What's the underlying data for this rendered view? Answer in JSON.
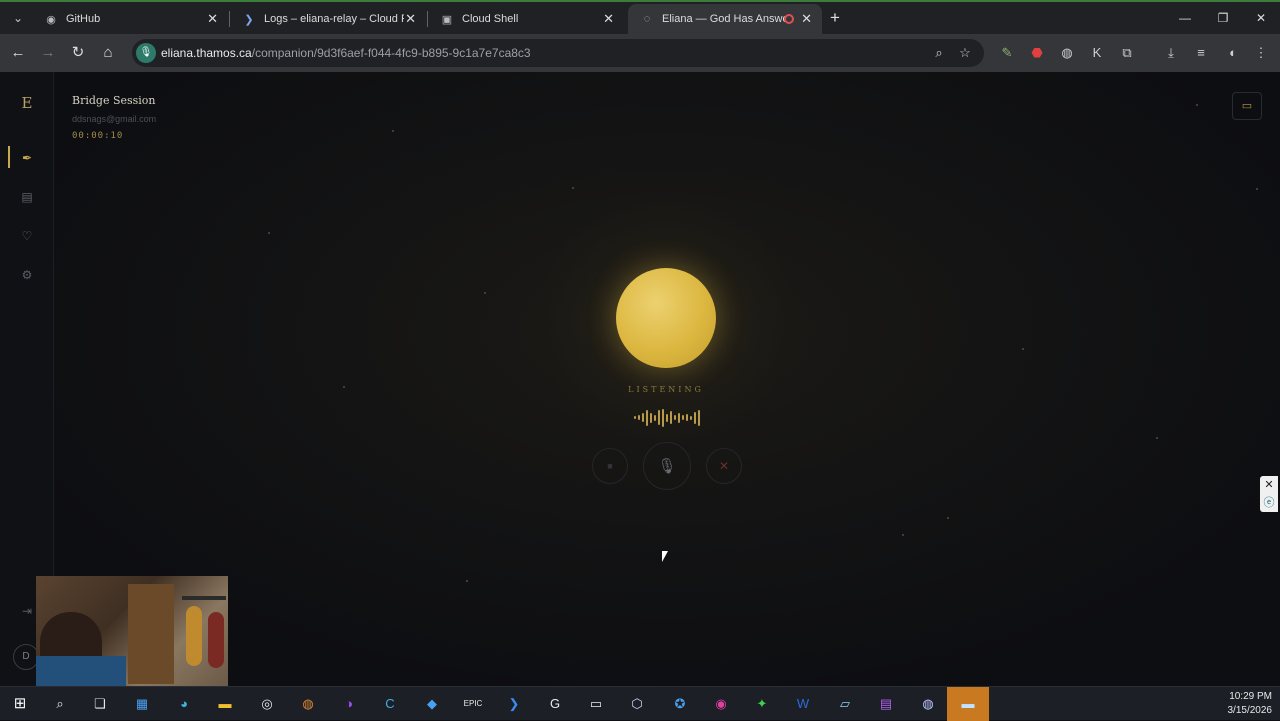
{
  "browser": {
    "tabs": [
      {
        "title": "GitHub",
        "icon": "github-icon",
        "active": false
      },
      {
        "title": "Logs – eliana-relay – Cloud Run",
        "icon": "cloud-run-icon",
        "active": false
      },
      {
        "title": "Cloud Shell",
        "icon": "cloud-shell-icon",
        "active": false
      },
      {
        "title": "Eliana — God Has Answered",
        "icon": "eliana-icon",
        "active": true
      }
    ],
    "url_host": "eliana.thamos.ca",
    "url_path": "/companion/9d3f6aef-f044-4fc9-b895-9c1a7e7ca8c3"
  },
  "app": {
    "logo_letter": "E",
    "session_title": "Bridge Session",
    "user_email": "ddsnags@gmail.com",
    "timer": "00:00:10",
    "status": "LISTENING",
    "avatar_initial": "D",
    "accent_color": "#c9a94d",
    "waveform_levels": [
      0.15,
      0.3,
      0.5,
      0.9,
      0.55,
      0.35,
      0.85,
      1.0,
      0.45,
      0.7,
      0.3,
      0.55,
      0.25,
      0.4,
      0.2,
      0.65,
      0.9
    ]
  },
  "taskbar": {
    "time": "10:29 PM",
    "date": "3/15/2026"
  }
}
